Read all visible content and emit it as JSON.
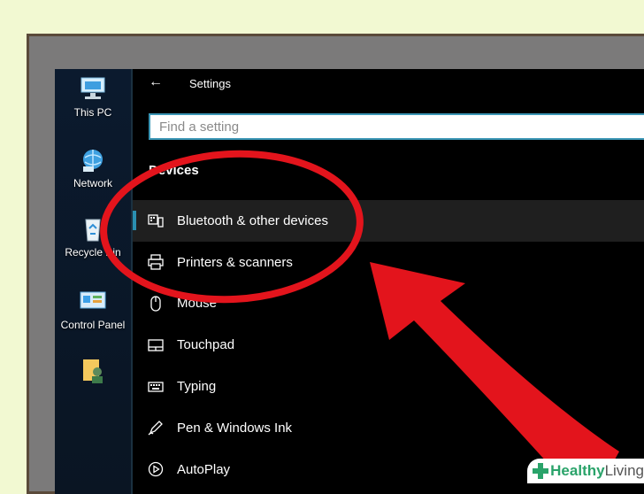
{
  "desktop": {
    "icons": [
      {
        "label": "This PC",
        "icon": "this-pc-icon"
      },
      {
        "label": "Network",
        "icon": "network-icon"
      },
      {
        "label": "Recycle Bin",
        "icon": "recycle-bin-icon"
      },
      {
        "label": "Control Panel",
        "icon": "control-panel-icon"
      },
      {
        "label": "",
        "icon": "user-folder-icon"
      }
    ]
  },
  "settings": {
    "back_icon": "back-arrow-icon",
    "title": "Settings",
    "search_placeholder": "Find a setting",
    "section": "Devices",
    "items": [
      {
        "label": "Bluetooth & other devices",
        "icon": "bluetooth-devices-icon",
        "selected": true
      },
      {
        "label": "Printers & scanners",
        "icon": "printer-icon",
        "selected": false
      },
      {
        "label": "Mouse",
        "icon": "mouse-icon",
        "selected": false
      },
      {
        "label": "Touchpad",
        "icon": "touchpad-icon",
        "selected": false
      },
      {
        "label": "Typing",
        "icon": "keyboard-icon",
        "selected": false
      },
      {
        "label": "Pen & Windows Ink",
        "icon": "pen-icon",
        "selected": false
      },
      {
        "label": "AutoPlay",
        "icon": "autoplay-icon",
        "selected": false
      }
    ]
  },
  "annotation": {
    "color": "#e3141c"
  },
  "watermark": {
    "part1": "Healthy",
    "part2": "Living"
  }
}
